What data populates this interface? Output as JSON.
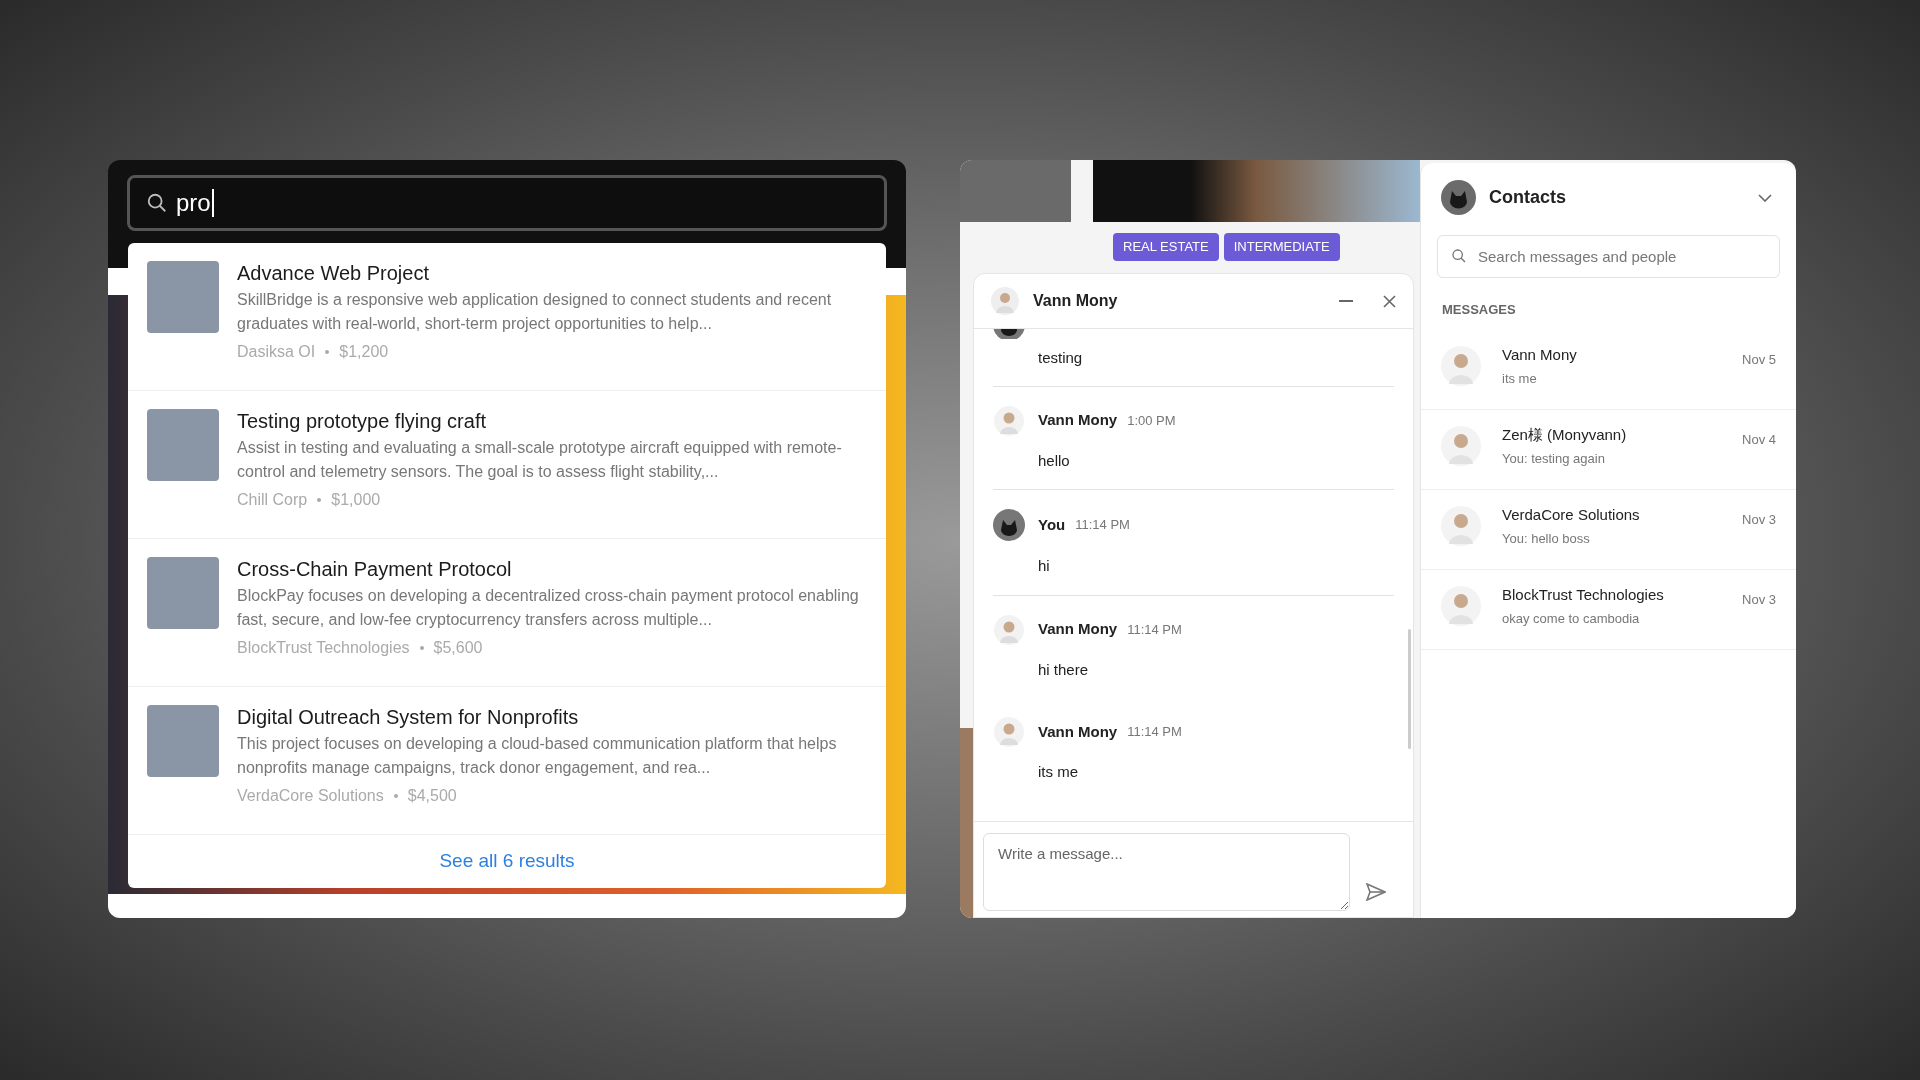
{
  "search_panel": {
    "query": "pro",
    "results": [
      {
        "title": "Advance Web Project",
        "description": "SkillBridge is a responsive web application designed to connect students and recent graduates with real-world, short-term project opportunities to help...",
        "company": "Dasiksa OI",
        "price": "$1,200"
      },
      {
        "title": "Testing prototype flying craft",
        "description": "Assist in testing and evaluating a small-scale prototype aircraft equipped with remote-control and telemetry sensors. The goal is to assess flight stability,...",
        "company": "Chill Corp",
        "price": "$1,000"
      },
      {
        "title": "Cross-Chain Payment Protocol",
        "description": "BlockPay focuses on developing a decentralized cross-chain payment protocol enabling fast, secure, and low-fee cryptocurrency transfers across multiple...",
        "company": "BlockTrust Technologies",
        "price": "$5,600"
      },
      {
        "title": "Digital Outreach System for Nonprofits",
        "description": "This project focuses on developing a cloud-based communication platform that helps nonprofits manage campaigns, track donor engagement, and rea...",
        "company": "VerdaCore Solutions",
        "price": "$4,500"
      }
    ],
    "see_all": "See all 6 results"
  },
  "page_tags": [
    "REAL ESTATE",
    "INTERMEDIATE"
  ],
  "chat": {
    "title": "Vann Mony",
    "messages": [
      {
        "kind": "cut",
        "text": "testing",
        "divider": true
      },
      {
        "kind": "other",
        "sender": "Vann Mony",
        "time": "1:00 PM",
        "text": "hello",
        "divider": true
      },
      {
        "kind": "self",
        "sender": "You",
        "time": "11:14 PM",
        "text": "hi",
        "divider": true
      },
      {
        "kind": "other",
        "sender": "Vann Mony",
        "time": "11:14 PM",
        "text": "hi there",
        "divider": false
      },
      {
        "kind": "other",
        "sender": "Vann Mony",
        "time": "11:14 PM",
        "text": "its me",
        "divider": false
      }
    ],
    "input": {
      "placeholder": "Write a message..."
    }
  },
  "contacts": {
    "title": "Contacts",
    "search": {
      "placeholder": "Search messages and people"
    },
    "section": "MESSAGES",
    "conversations": [
      {
        "name": "Vann Mony",
        "preview": "its me",
        "date": "Nov 5"
      },
      {
        "name": "Zen様 (Monyvann)",
        "preview": "You: testing again",
        "date": "Nov 4"
      },
      {
        "name": "VerdaCore Solutions",
        "preview": "You: hello boss",
        "date": "Nov 3"
      },
      {
        "name": "BlockTrust Technologies",
        "preview": "okay come to cambodia",
        "date": "Nov 3"
      }
    ]
  }
}
